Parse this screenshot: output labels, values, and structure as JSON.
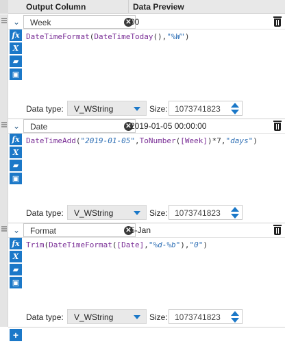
{
  "header": {
    "col_output": "Output Column",
    "col_preview": "Data Preview"
  },
  "rows": [
    {
      "name": "Week",
      "preview": "00",
      "expr": [
        {
          "t": "DateTimeFormat",
          "c": "fn"
        },
        {
          "t": "(",
          "c": ""
        },
        {
          "t": "DateTimeToday",
          "c": "fn"
        },
        {
          "t": "(),",
          "c": ""
        },
        {
          "t": "\"%W\"",
          "c": "str"
        },
        {
          "t": ")",
          "c": ""
        }
      ],
      "data_type_label": "Data type:",
      "data_type": "V_WString",
      "size_label": "Size:",
      "size": "1073741823"
    },
    {
      "name": "Date",
      "preview": "2019-01-05 00:00:00",
      "expr": [
        {
          "t": "DateTimeAdd",
          "c": "fn"
        },
        {
          "t": "(",
          "c": ""
        },
        {
          "t": "\"2019-01-05\"",
          "c": "str"
        },
        {
          "t": ",",
          "c": ""
        },
        {
          "t": "ToNumber",
          "c": "fn"
        },
        {
          "t": "(",
          "c": ""
        },
        {
          "t": "[Week]",
          "c": "field"
        },
        {
          "t": ")*7,",
          "c": ""
        },
        {
          "t": "\"days\"",
          "c": "str"
        },
        {
          "t": ")",
          "c": ""
        }
      ],
      "data_type_label": "Data type:",
      "data_type": "V_WString",
      "size_label": "Size:",
      "size": "1073741823"
    },
    {
      "name": "Format",
      "preview": "5-Jan",
      "expr": [
        {
          "t": "Trim",
          "c": "fn"
        },
        {
          "t": "(",
          "c": ""
        },
        {
          "t": "DateTimeFormat",
          "c": "fn"
        },
        {
          "t": "(",
          "c": ""
        },
        {
          "t": "[Date]",
          "c": "field"
        },
        {
          "t": ",",
          "c": ""
        },
        {
          "t": "\"%d-%b\"",
          "c": "str"
        },
        {
          "t": "),",
          "c": ""
        },
        {
          "t": "\"0\"",
          "c": "str"
        },
        {
          "t": ")",
          "c": ""
        }
      ],
      "data_type_label": "Data type:",
      "data_type": "V_WString",
      "size_label": "Size:",
      "size": "1073741823"
    }
  ],
  "tool_icons": [
    "fx-icon",
    "variable-x-icon",
    "open-folder-icon",
    "save-icon"
  ],
  "tool_glyphs": {
    "fx": "fx",
    "x": "X",
    "folder": "▰",
    "save": "▣"
  },
  "add_button": "+",
  "colors": {
    "accent": "#1b78c8",
    "function": "#7a2f96",
    "string": "#2e6fb5"
  }
}
